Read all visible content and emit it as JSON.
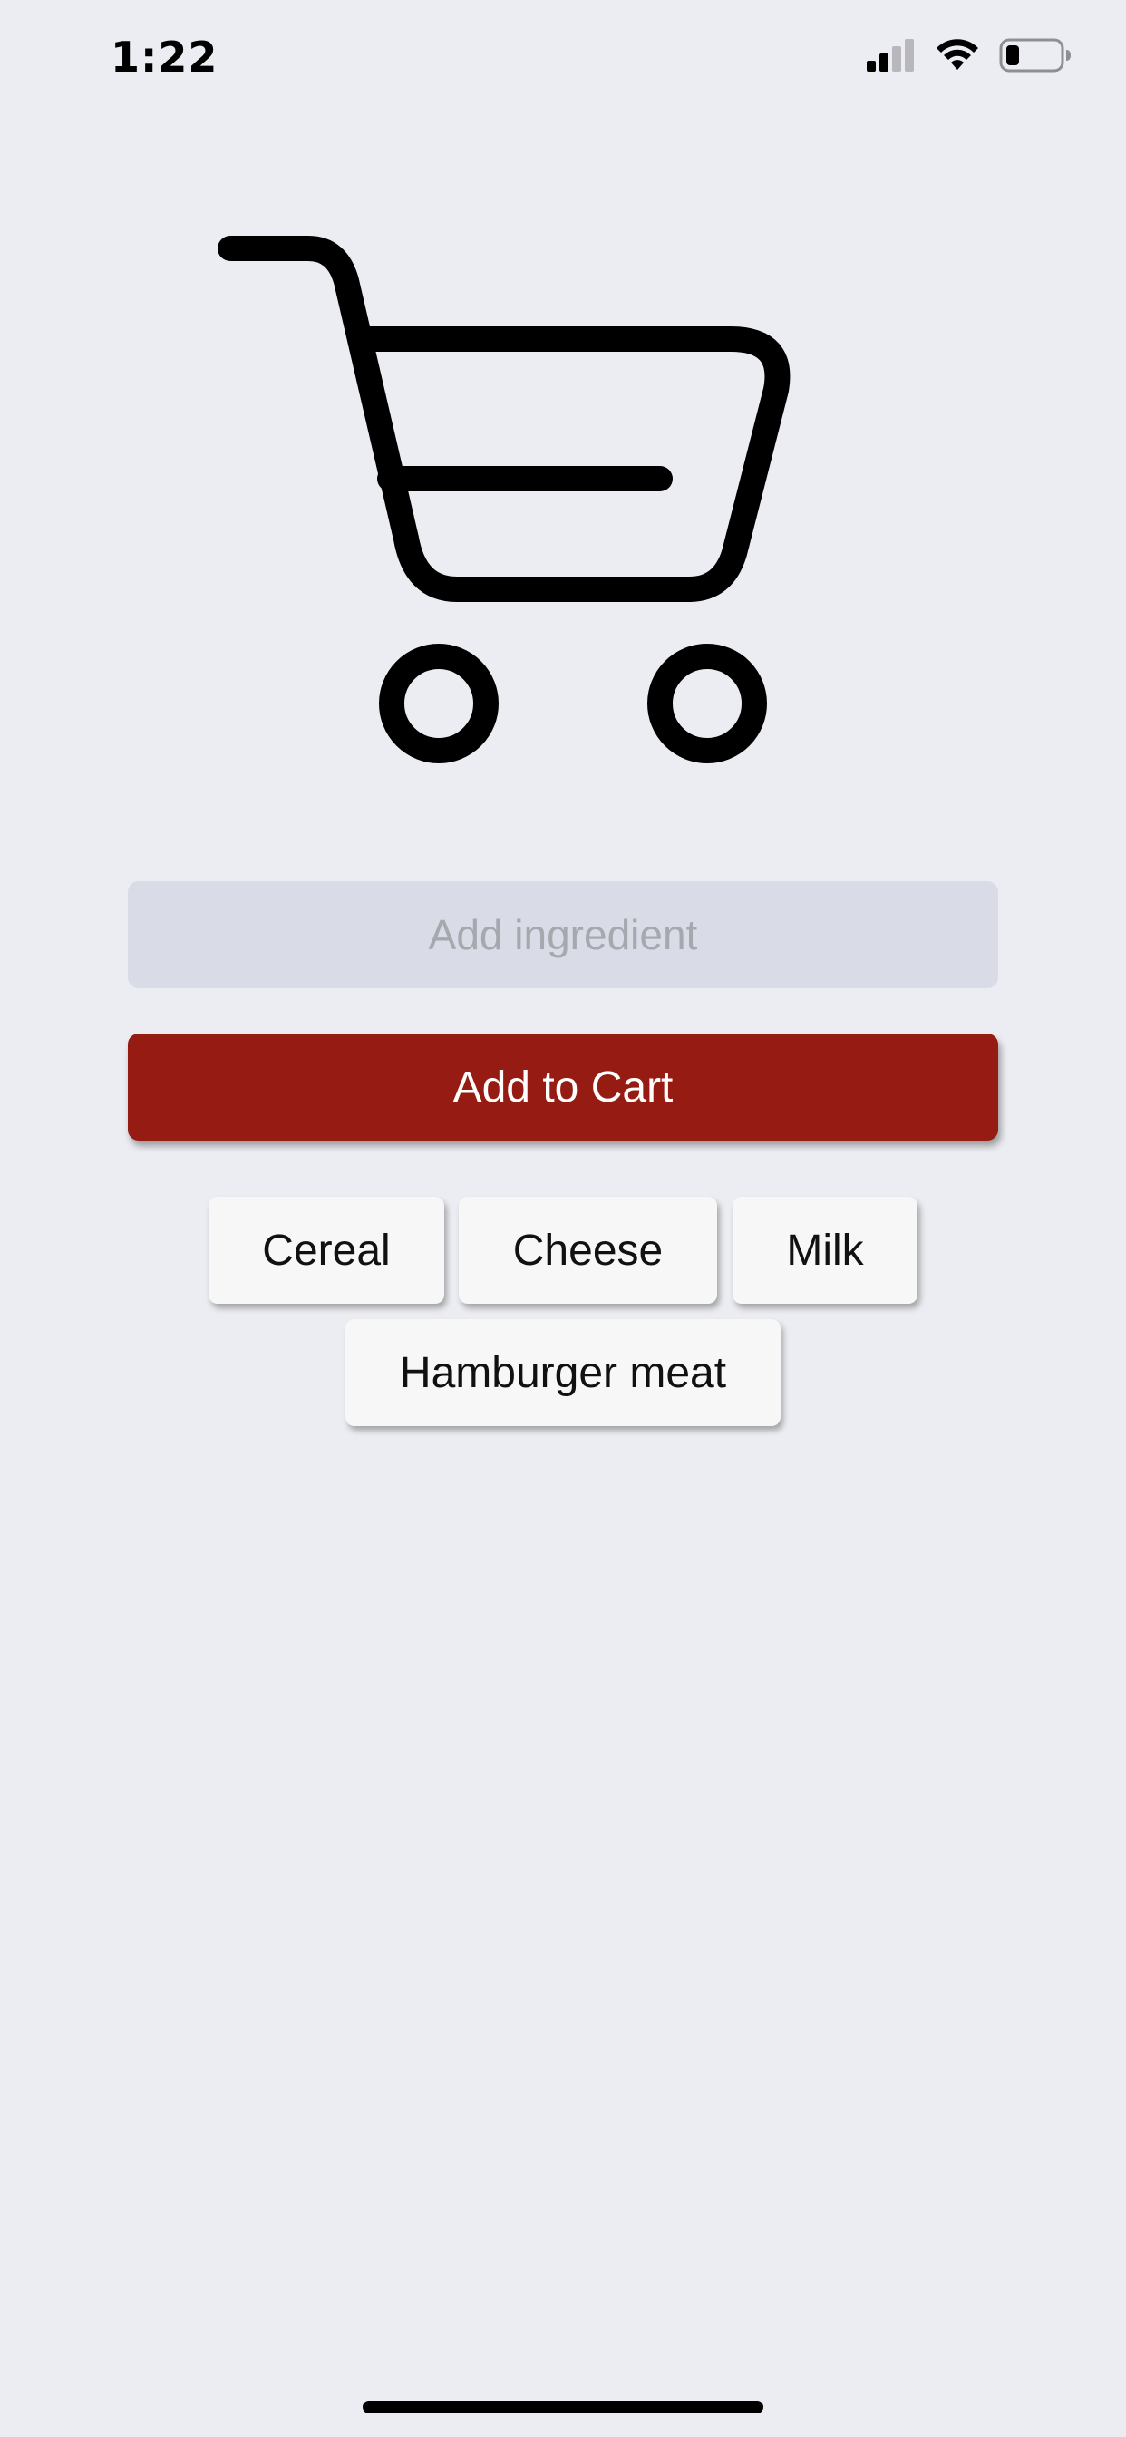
{
  "status_bar": {
    "time": "1:22",
    "icons": [
      "cellular-signal-icon",
      "wifi-icon",
      "battery-icon"
    ]
  },
  "hero": {
    "icon": "shopping-cart-icon"
  },
  "form": {
    "ingredient_input": {
      "value": "",
      "placeholder": "Add ingredient"
    },
    "add_button_label": "Add to Cart"
  },
  "suggestions": [
    {
      "label": "Cereal"
    },
    {
      "label": "Cheese"
    },
    {
      "label": "Milk"
    },
    {
      "label": "Hamburger meat"
    }
  ],
  "colors": {
    "background": "#ecedf2",
    "accent": "#961b13",
    "input_bg": "#d9dbe6",
    "chip_bg": "#f7f7f7"
  }
}
